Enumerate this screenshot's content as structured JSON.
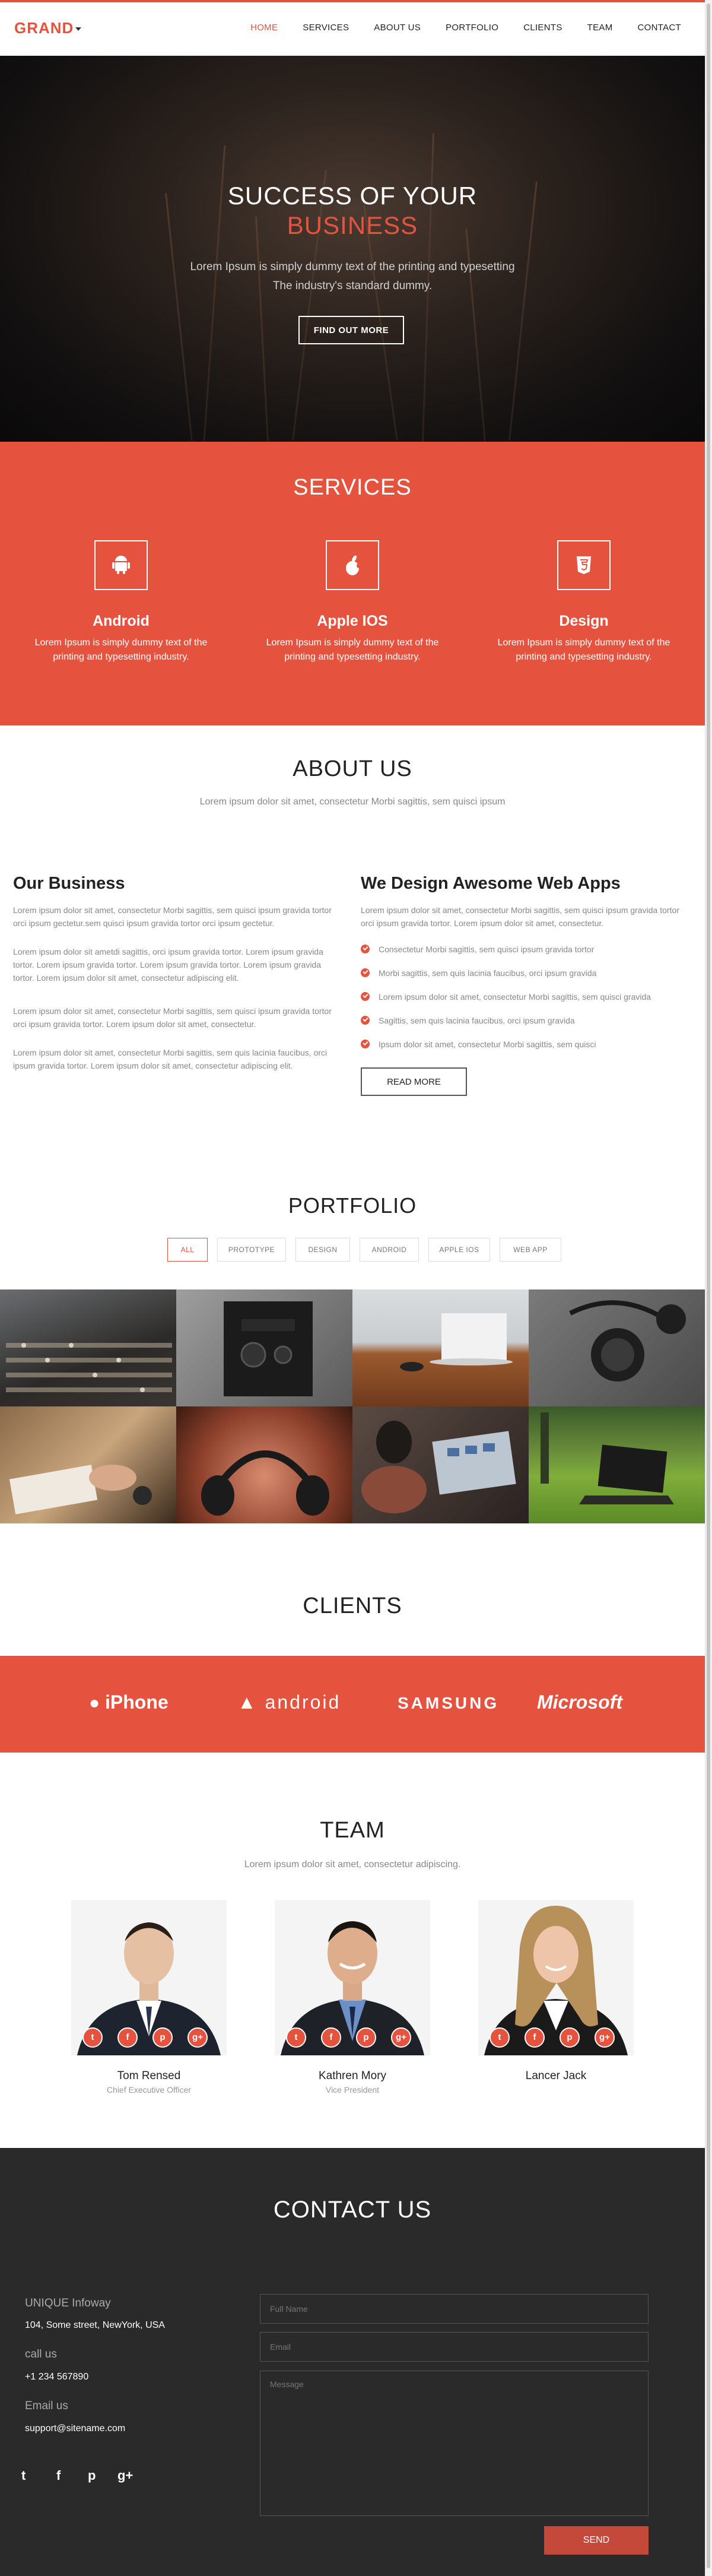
{
  "brand": {
    "name": "GRAND",
    "accent": "#e5533f",
    "dark": "#2a2a2a"
  },
  "nav": [
    "HOME",
    "SERVICES",
    "ABOUT US",
    "PORTFOLIO",
    "CLIENTS",
    "TEAM",
    "CONTACT"
  ],
  "hero": {
    "title_line1": "SUCCESS OF YOUR",
    "title_line2": "BUSINESS",
    "subtitle_line1": "Lorem Ipsum is simply dummy text of the printing and typesetting",
    "subtitle_line2": "The industry's standard dummy.",
    "button": "FIND OUT MORE"
  },
  "services": {
    "title": "SERVICES",
    "items": [
      {
        "icon": "android-icon",
        "name": "Android",
        "text": "Lorem Ipsum is simply dummy text of the printing and typesetting industry."
      },
      {
        "icon": "apple-icon",
        "name": "Apple IOS",
        "text": "Lorem Ipsum is simply dummy text of the printing and typesetting industry."
      },
      {
        "icon": "html5-icon",
        "name": "Design",
        "text": "Lorem Ipsum is simply dummy text of the printing and typesetting industry."
      }
    ]
  },
  "about": {
    "title": "ABOUT US",
    "subtitle": "Lorem ipsum dolor sit amet, consectetur Morbi sagittis, sem quisci ipsum",
    "left_title": "Our Business",
    "left_paragraphs": [
      "Lorem ipsum dolor sit amet, consectetur Morbi sagittis, sem quisci ipsum gravida tortor orci ipsum gectetur.sem quisci ipsum gravida tortor orci ipsum gectetur.",
      "Lorem ipsum dolor sit ametdi sagittis, orci ipsum gravida tortor. Lorem ipsum gravida tortor. Lorem ipsum gravida tortor. Lorem ipsum gravida tortor. Lorem ipsum gravida tortor. Lorem ipsum dolor sit amet, consectetur adipiscing elit.",
      "Lorem ipsum dolor sit amet, consectetur Morbi sagittis, sem quisci ipsum gravida tortor orci ipsum gravida tortor. Lorem ipsum dolor sit amet, consectetur.",
      "Lorem ipsum dolor sit amet, consectetur Morbi sagittis, sem quis lacinia faucibus, orci ipsum gravida tortor. Lorem ipsum dolor sit amet, consectetur adipiscing elit."
    ],
    "right_title": "We Design Awesome Web Apps",
    "right_paragraph": "Lorem ipsum dolor sit amet, consectetur Morbi sagittis, sem quisci ipsum gravida tortor orci ipsum gravida tortor. Lorem ipsum dolor sit amet, consectetur.",
    "checklist": [
      "Consectetur Morbi sagittis, sem quisci ipsum gravida tortor",
      "Morbi sagittis, sem quis lacinia faucibus, orci ipsum gravida",
      "Lorem ipsum dolor sit amet, consectetur Morbi sagittis, sem quisci gravida",
      "Sagittis, sem quis lacinia faucibus, orci ipsum gravida",
      "Ipsum dolor sit amet, consectetur Morbi sagittis, sem quisci"
    ],
    "button": "READ MORE"
  },
  "portfolio": {
    "title": "PORTFOLIO",
    "filters": [
      "ALL",
      "PROTOTYPE",
      "DESIGN",
      "ANDROID",
      "APPLE IOS",
      "WEB APP"
    ],
    "active_filter": "ALL",
    "tiles": [
      "mixing-console",
      "amplifier-knobs",
      "laptop-on-desk",
      "headphones",
      "hands-writing",
      "headphones-closeup",
      "laptop-meeting",
      "laptop-on-grass"
    ]
  },
  "clients": {
    "title": "CLIENTS",
    "logos": [
      "iPhone",
      "android",
      "SAMSUNG",
      "Microsoft"
    ]
  },
  "team": {
    "title": "TEAM",
    "subtitle": "Lorem ipsum dolor sit amet, consectetur adipiscing.",
    "members": [
      {
        "name": "Tom Rensed",
        "role": "Chief Executive Officer"
      },
      {
        "name": "Kathren Mory",
        "role": "Vice President"
      },
      {
        "name": "Lancer Jack",
        "role": ""
      }
    ],
    "social_icons": [
      "twitter-icon",
      "facebook-icon",
      "pinterest-icon",
      "google-plus-icon"
    ]
  },
  "contact": {
    "title": "CONTACT US",
    "company": "UNIQUE Infoway",
    "address": "104, Some street, NewYork, USA",
    "call_label": "call us",
    "phone": "+1 234 567890",
    "email_label": "Email us",
    "email": "support@sitename.com",
    "fullname_placeholder": "Full Name",
    "email_placeholder": "Email",
    "message_placeholder": "Message",
    "send": "SEND"
  }
}
